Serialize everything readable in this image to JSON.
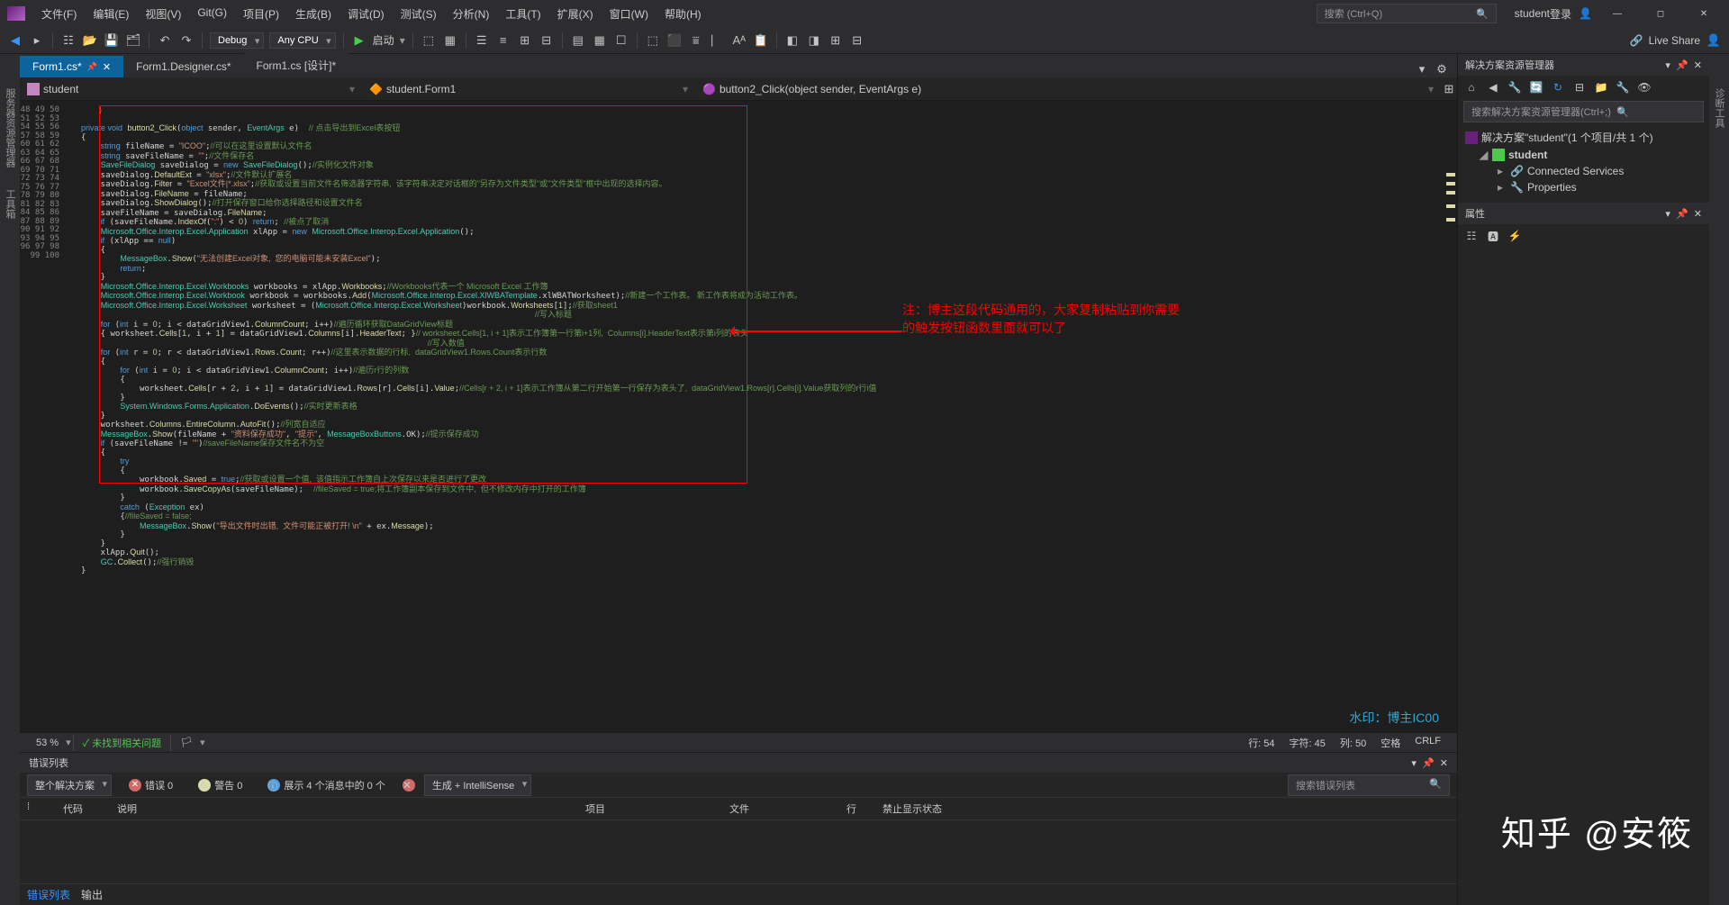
{
  "titlebar": {
    "login": "登录",
    "project": "student"
  },
  "menu": {
    "file": "文件(F)",
    "edit": "编辑(E)",
    "view": "视图(V)",
    "git": "Git(G)",
    "project": "项目(P)",
    "build": "生成(B)",
    "debug": "调试(D)",
    "test": "测试(S)",
    "analyze": "分析(N)",
    "tools": "工具(T)",
    "extensions": "扩展(X)",
    "window": "窗口(W)",
    "help": "帮助(H)"
  },
  "search": {
    "placeholder": "搜索 (Ctrl+Q)"
  },
  "toolbar": {
    "config": "Debug",
    "platform": "Any CPU",
    "start": "启动",
    "liveshare": "Live Share"
  },
  "lefttabs": {
    "server": "服务器资源管理器",
    "toolbox": "工具箱"
  },
  "tabs": {
    "t1": "Form1.cs*",
    "t2": "Form1.Designer.cs*",
    "t3": "Form1.cs [设计]*"
  },
  "breadcrumb": {
    "b1": "student",
    "b2": "student.Form1",
    "b3": "button2_Click(object sender, EventArgs e)"
  },
  "statusline": {
    "zoom": "53 %",
    "issues": "未找到相关问题",
    "ln": "行: 54",
    "ch": "字符: 45",
    "col": "列: 50",
    "spc": "空格",
    "crlf": "CRLF"
  },
  "errorlist": {
    "title": "错误列表",
    "scope": "整个解决方案",
    "errors": "错误 0",
    "warnings": "警告 0",
    "info": "展示 4 个消息中的 0 个",
    "build": "生成 + IntelliSense",
    "search": "搜索错误列表",
    "cols": {
      "code": "代码",
      "desc": "说明",
      "proj": "项目",
      "file": "文件",
      "line": "行",
      "supp": "禁止显示状态"
    },
    "tab1": "错误列表",
    "tab2": "输出"
  },
  "solution": {
    "title": "解决方案资源管理器",
    "search": "搜索解决方案资源管理器(Ctrl+;)",
    "root": "解决方案\"student\"(1 个项目/共 1 个)",
    "proj": "student",
    "cs": "Connected Services",
    "props": "Properties"
  },
  "properties": {
    "title": "属性"
  },
  "righttabs": {
    "diag": "诊断工具"
  },
  "annotation": {
    "line1": "注：博主这段代码通用的，大家复制粘贴到你需要",
    "line2": "的触发按钮函数里面就可以了"
  },
  "watermark": "水印：博主IC00",
  "zhihu": "知乎 @安筱",
  "code_lines": [
    48,
    49,
    50,
    51,
    52,
    53,
    54,
    55,
    56,
    57,
    58,
    59,
    60,
    61,
    62,
    63,
    64,
    65,
    66,
    67,
    68,
    69,
    70,
    71,
    72,
    73,
    74,
    75,
    76,
    77,
    78,
    79,
    80,
    81,
    82,
    83,
    84,
    85,
    86,
    87,
    88,
    89,
    90,
    91,
    92,
    93,
    94,
    95,
    96,
    97,
    98,
    99,
    100
  ]
}
